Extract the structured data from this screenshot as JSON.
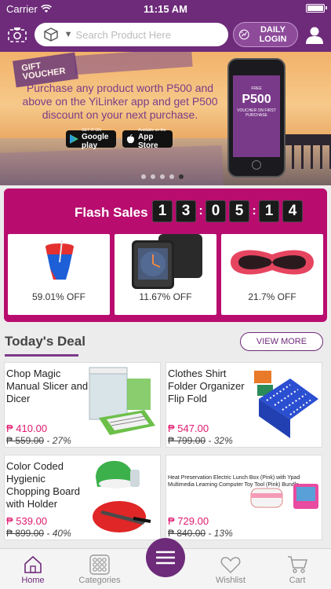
{
  "status": {
    "carrier": "Carrier",
    "time": "11:15 AM"
  },
  "header": {
    "search_placeholder": "Search Product Here",
    "daily_login": "DAILY LOGIN"
  },
  "banner": {
    "voucher_tag": "GIFT VOUCHER",
    "promo_text": "Purchase any product worth P500 and above on the YiLinker app and get P500 discount on your next purchase.",
    "google_play_small": "GET IT ON",
    "google_play": "Google play",
    "app_store_small": "Available on the",
    "app_store": "App Store",
    "phone_top": "FREE",
    "phone_amount": "P500",
    "phone_bottom": "VOUCHER ON FIRST PURCHASE",
    "slides": 5,
    "active_slide": 5
  },
  "flash_sales": {
    "title": "Flash Sales",
    "timer": [
      "1",
      "3",
      "0",
      "5",
      "1",
      "4"
    ],
    "items": [
      {
        "discount": "59.01% OFF"
      },
      {
        "discount": "11.67% OFF"
      },
      {
        "discount": "21.7% OFF"
      }
    ]
  },
  "todays_deal": {
    "title": "Today's Deal",
    "view_more": "VIEW MORE",
    "items": [
      {
        "name": "Chop Magic Manual Slicer and Dicer",
        "price": "₱ 410.00",
        "old_price": "₱ 559.00",
        "discount": "- 27%"
      },
      {
        "name": "Clothes Shirt Folder Organizer Flip Fold",
        "price": "₱ 547.00",
        "old_price": "₱ 799.00",
        "discount": "- 32%"
      },
      {
        "name": "Color Coded Hygienic Chopping Board with Holder",
        "price": "₱ 539.00",
        "old_price": "₱ 899.00",
        "discount": "- 40%"
      },
      {
        "name": "Heat Preservation Electric Lunch Box (Pink) with Ypad Multimedia Learning Computer Toy Tool (Pink) Bundle",
        "price": "₱ 729.00",
        "old_price": "₱ 840.00",
        "discount": "- 13%"
      }
    ]
  },
  "tabbar": {
    "home": "Home",
    "categories": "Categories",
    "wishlist": "Wishlist",
    "cart": "Cart"
  },
  "colors": {
    "brand": "#6e2b7a",
    "flash": "#b80d6f",
    "price": "#e0196e"
  }
}
